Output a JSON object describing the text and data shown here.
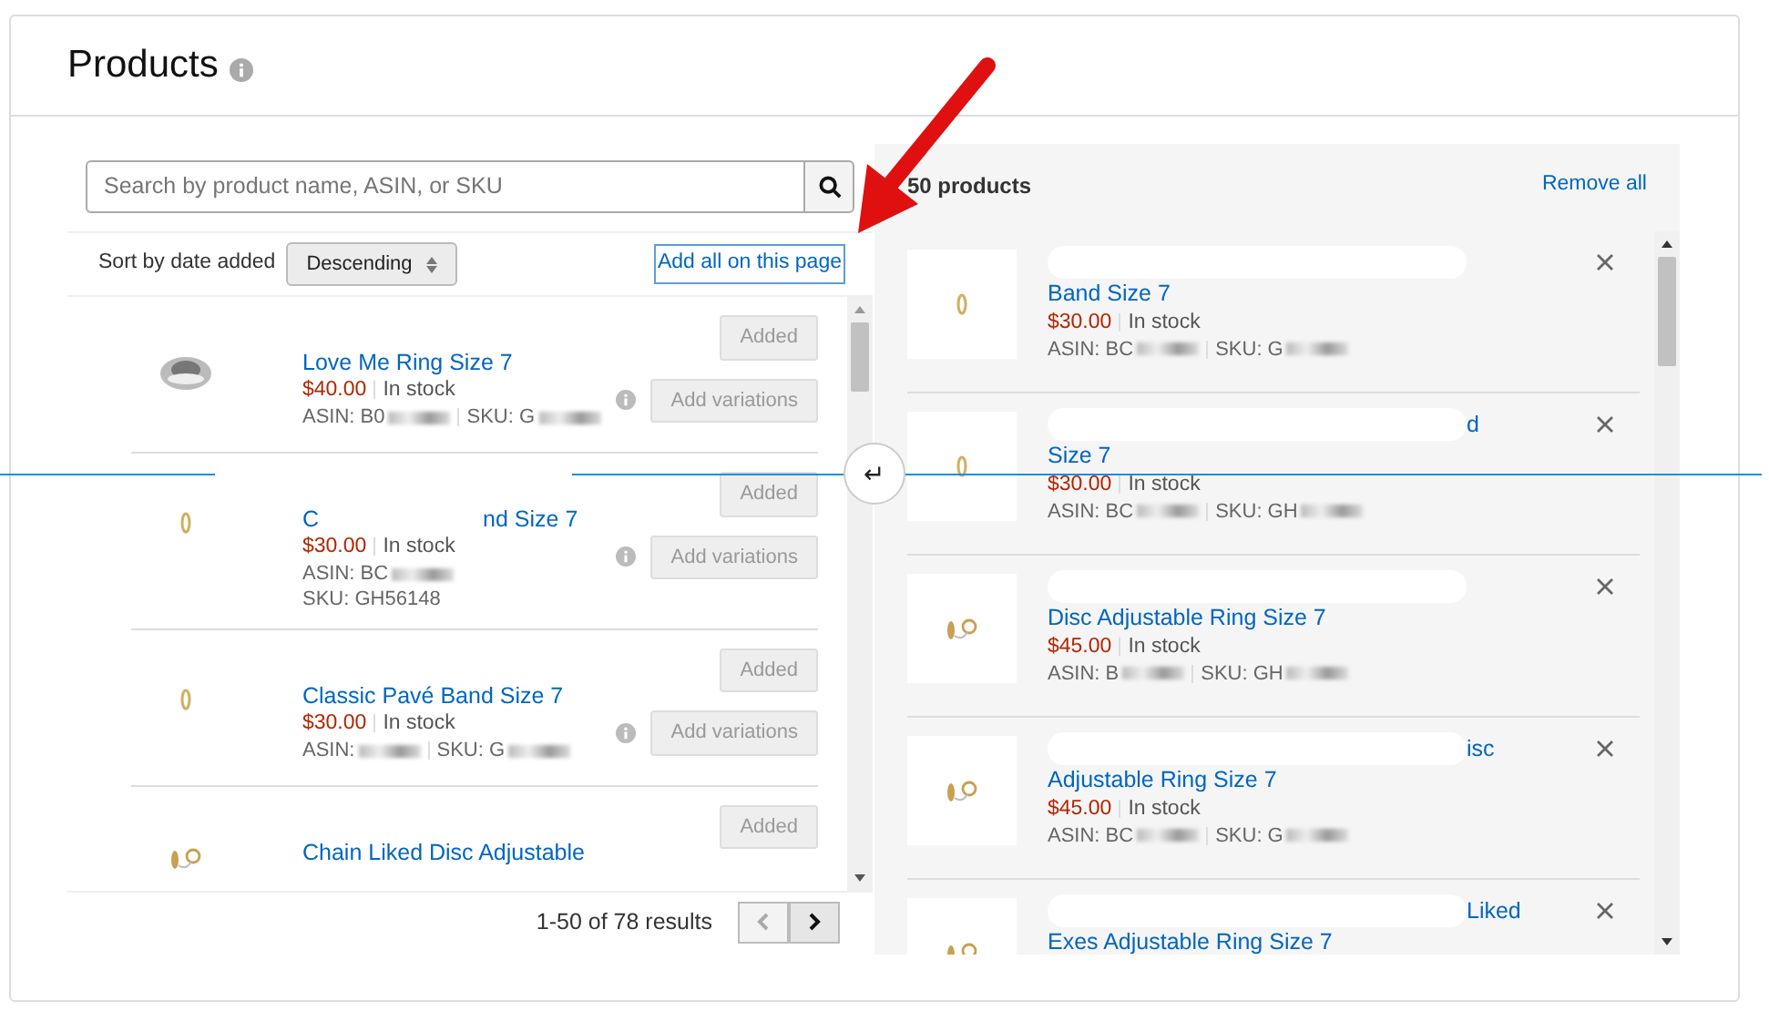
{
  "title": "Products",
  "search": {
    "placeholder": "Search by product name, ASIN, or SKU"
  },
  "sort": {
    "label": "Sort by date added",
    "value": "Descending"
  },
  "add_all": "Add all on this page",
  "catalog": [
    {
      "title": "Love Me Ring Size 7",
      "price": "$40.00",
      "stock": "In stock",
      "asin": "ASIN: B0",
      "sku": "SKU: G",
      "added": {
        "label": "Added",
        "disabled": true
      },
      "variations": {
        "label": "Add variations",
        "disabled": true
      }
    },
    {
      "title_start": "C",
      "title": "nd Size 7",
      "price": "$30.00",
      "stock": "In stock",
      "asin": "ASIN: BC",
      "sku_line": "SKU: GH56148",
      "added": {
        "label": "Added",
        "disabled": true
      },
      "variations": {
        "label": "Add variations",
        "disabled": true
      }
    },
    {
      "title": "Classic Pavé Band Size 7",
      "price": "$30.00",
      "stock": "In stock",
      "asin": "ASIN:",
      "sku": "SKU: G",
      "added": {
        "label": "Added",
        "disabled": true
      },
      "variations": {
        "label": "Add variations",
        "disabled": true
      }
    },
    {
      "title": "Chain Liked Disc Adjustable",
      "added": {
        "label": "Added",
        "disabled": true
      }
    }
  ],
  "pagination": {
    "summary": "1-50 of 78 results",
    "prev_disabled": true,
    "next_disabled": false
  },
  "selected_panel": {
    "count": "50 products",
    "remove_all": "Remove all",
    "items": [
      {
        "title": "Band Size 7",
        "price": "$30.00",
        "stock": "In stock",
        "asin": "ASIN: BC",
        "sku": "SKU: G"
      },
      {
        "fragment": "d",
        "title": "Size 7",
        "price": "$30.00",
        "stock": "In stock",
        "asin": "ASIN: BC",
        "sku": "SKU: GH"
      },
      {
        "title": "Disc Adjustable Ring Size 7",
        "price": "$45.00",
        "stock": "In stock",
        "asin": "ASIN: B",
        "sku": "SKU: GH"
      },
      {
        "fragment": "isc",
        "title": "Adjustable Ring Size 7",
        "price": "$45.00",
        "stock": "In stock",
        "asin": "ASIN: BC",
        "sku": "SKU: G"
      },
      {
        "fragment": "Liked",
        "title": "Exes Adjustable Ring Size 7"
      }
    ]
  },
  "return_key": "↵"
}
